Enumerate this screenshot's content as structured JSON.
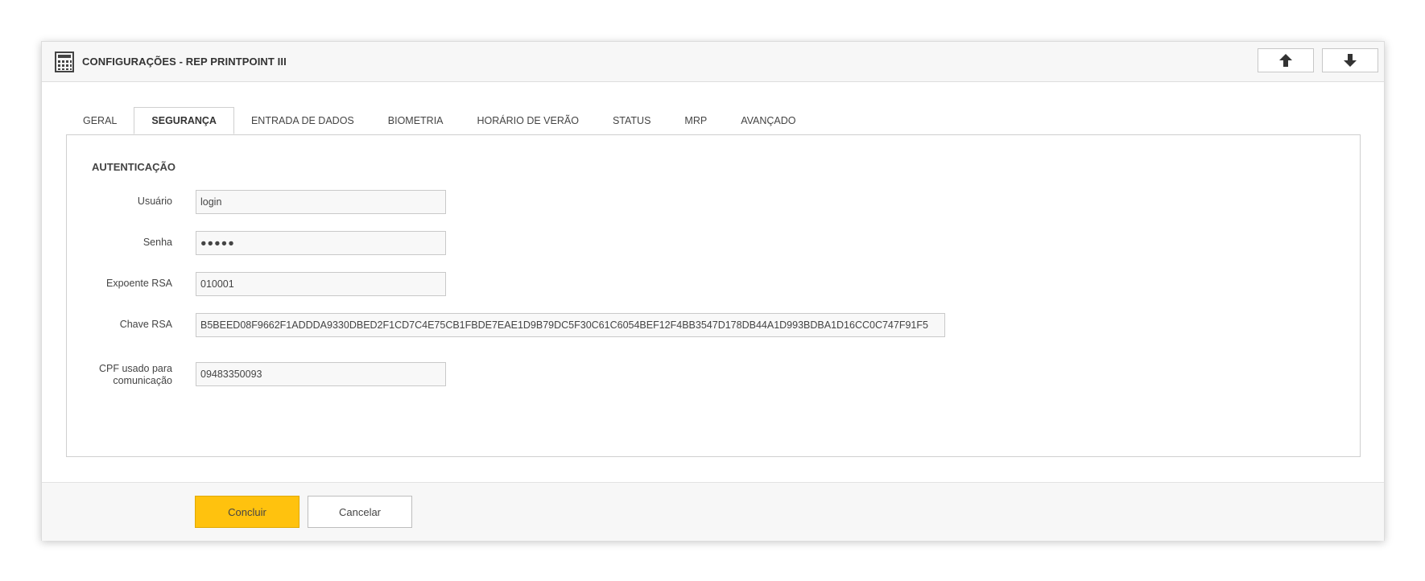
{
  "header": {
    "title": "CONFIGURAÇÕES - REP PRINTPOINT III",
    "icon": "calculator-icon",
    "up_icon": "arrow-up-icon",
    "down_icon": "arrow-down-icon"
  },
  "tabs": [
    {
      "label": "GERAL"
    },
    {
      "label": "SEGURANÇA",
      "active": true
    },
    {
      "label": "ENTRADA DE DADOS"
    },
    {
      "label": "BIOMETRIA"
    },
    {
      "label": "HORÁRIO DE VERÃO"
    },
    {
      "label": "STATUS"
    },
    {
      "label": "MRP"
    },
    {
      "label": "AVANÇADO"
    }
  ],
  "section": {
    "title": "AUTENTICAÇÃO"
  },
  "form": {
    "usuario": {
      "label": "Usuário",
      "value": "login"
    },
    "senha": {
      "label": "Senha",
      "value": "●●●●●"
    },
    "expoente": {
      "label": "Expoente RSA",
      "value": "010001"
    },
    "chave": {
      "label": "Chave RSA",
      "value": "B5BEED08F9662F1ADDDA9330DBED2F1CD7C4E75CB1FBDE7EAE1D9B79DC5F30C61C6054BEF12F4BB3547D178DB44A1D993BDBA1D16CC0C747F91F5"
    },
    "cpf": {
      "label_line1": "CPF usado para",
      "label_line2": "comunicação",
      "value": "09483350093"
    }
  },
  "footer": {
    "confirm_label": "Concluir",
    "cancel_label": "Cancelar"
  },
  "colors": {
    "accent": "#ffc20e",
    "header_bg": "#f7f7f7"
  }
}
